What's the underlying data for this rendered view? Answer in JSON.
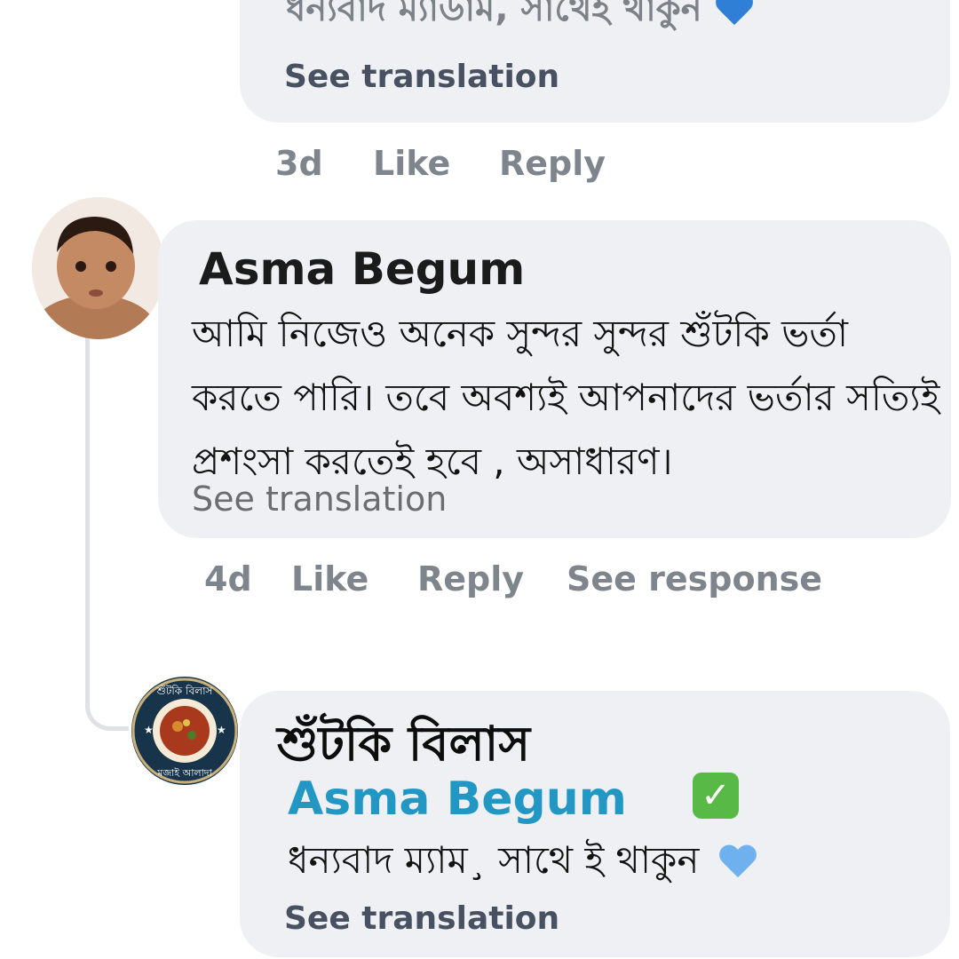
{
  "top_comment": {
    "text": "ধন্যবাদ ম্যাডাম, সাথেই থাকুন",
    "see_translation": "See translation",
    "meta": {
      "time": "3d",
      "like": "Like",
      "reply": "Reply"
    }
  },
  "comment": {
    "author": "Asma Begum",
    "text": "আমি নিজেও অনেক সুন্দর সুন্দর শুঁটকি ভর্তা করতে পারি। তবে অবশ্যই আপনাদের ভর্তার সত্যিই প্রশংসা করতেই হবে , অসাধারণ।",
    "see_translation": "See translation",
    "meta": {
      "time": "4d",
      "like": "Like",
      "reply": "Reply",
      "see_response": "See response"
    }
  },
  "page_reply": {
    "page_name": "শুঁটকি বিলাস",
    "mention": "Asma Begum",
    "text": "ধন্যবাদ ম্যাম¸ সাথে ই থাকুন",
    "see_translation": "See translation",
    "logo": {
      "top_text": "শুঁটকি বিলাস",
      "bottom_text": "মজাই আলাদা"
    }
  },
  "colors": {
    "bubble": "#eff0f3",
    "mention": "#2397c3",
    "heart_dark": "#2f7fd6",
    "heart_light": "#6fb0ef",
    "check": "#58b947"
  },
  "icons": [
    "heart-icon",
    "check-mark-icon"
  ]
}
